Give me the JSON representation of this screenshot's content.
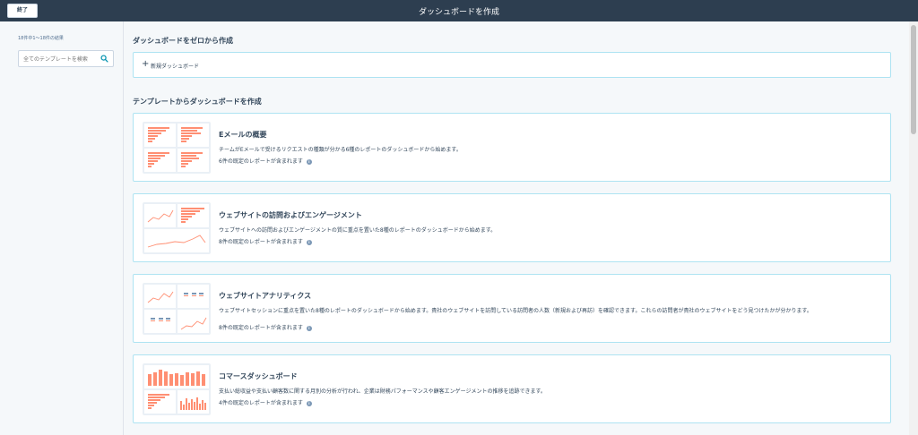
{
  "topbar": {
    "exit_label": "終了",
    "title": "ダッシュボードを作成"
  },
  "sidebar": {
    "result_count": "18件中1～18件の結果",
    "search_placeholder": "全てのテンプレートを検索",
    "search_icon": "search-icon"
  },
  "main": {
    "scratch_heading": "ダッシュボードをゼロから作成",
    "new_dashboard_label": "新規ダッシュボード",
    "template_heading": "テンプレートからダッシュボードを作成",
    "templates": [
      {
        "title": "Eメールの概要",
        "description": "チームがEメールで受けるリクエストの種類が分かる6種のレポートのダッシュボードから始めます。",
        "count": "6件の既定のレポートが含まれます"
      },
      {
        "title": "ウェブサイトの訪問およびエンゲージメント",
        "description": "ウェブサイトへの訪問およびエンゲージメントの質に重点を置いた8種のレポートのダッシュボードから始めます。",
        "count": "8件の既定のレポートが含まれます"
      },
      {
        "title": "ウェブサイトアナリティクス",
        "description": "ウェブサイトセッションに重点を置いた8種のレポートのダッシュボードから始めます。貴社のウェブサイトを訪問している訪問者の人数（新規および再訪）を確認できます。これらの訪問者が貴社のウェブサイトをどう見つけたかが分かります。",
        "count": "8件の既定のレポートが含まれます"
      },
      {
        "title": "コマースダッシュボード",
        "description": "支払い総収益や支払い顧客数に関する月別の分析が行われ、企業は財務パフォーマンスや顧客エンゲージメントの推移を追跡できます。",
        "count": "4件の既定のレポートが含まれます"
      }
    ]
  },
  "colors": {
    "topbar_bg": "#2d3e50",
    "card_border": "#aee3f2",
    "chart_accent": "#ff8f73",
    "text": "#33475b"
  }
}
